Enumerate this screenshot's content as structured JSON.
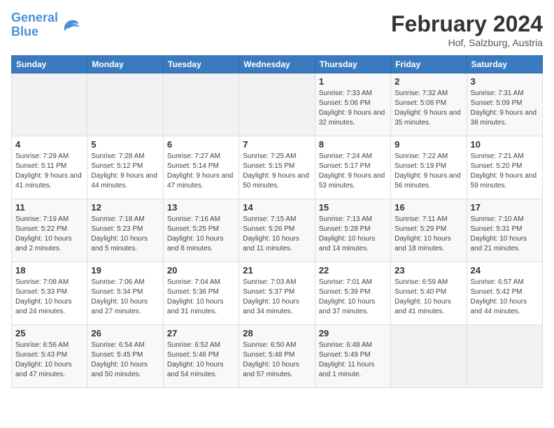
{
  "header": {
    "logo_line1": "General",
    "logo_line2": "Blue",
    "month_year": "February 2024",
    "location": "Hof, Salzburg, Austria"
  },
  "days_of_week": [
    "Sunday",
    "Monday",
    "Tuesday",
    "Wednesday",
    "Thursday",
    "Friday",
    "Saturday"
  ],
  "weeks": [
    [
      {
        "day": "",
        "sunrise": "",
        "sunset": "",
        "daylight": "",
        "empty": true
      },
      {
        "day": "",
        "sunrise": "",
        "sunset": "",
        "daylight": "",
        "empty": true
      },
      {
        "day": "",
        "sunrise": "",
        "sunset": "",
        "daylight": "",
        "empty": true
      },
      {
        "day": "",
        "sunrise": "",
        "sunset": "",
        "daylight": "",
        "empty": true
      },
      {
        "day": "1",
        "sunrise": "Sunrise: 7:33 AM",
        "sunset": "Sunset: 5:06 PM",
        "daylight": "Daylight: 9 hours and 32 minutes.",
        "empty": false
      },
      {
        "day": "2",
        "sunrise": "Sunrise: 7:32 AM",
        "sunset": "Sunset: 5:08 PM",
        "daylight": "Daylight: 9 hours and 35 minutes.",
        "empty": false
      },
      {
        "day": "3",
        "sunrise": "Sunrise: 7:31 AM",
        "sunset": "Sunset: 5:09 PM",
        "daylight": "Daylight: 9 hours and 38 minutes.",
        "empty": false
      }
    ],
    [
      {
        "day": "4",
        "sunrise": "Sunrise: 7:29 AM",
        "sunset": "Sunset: 5:11 PM",
        "daylight": "Daylight: 9 hours and 41 minutes.",
        "empty": false
      },
      {
        "day": "5",
        "sunrise": "Sunrise: 7:28 AM",
        "sunset": "Sunset: 5:12 PM",
        "daylight": "Daylight: 9 hours and 44 minutes.",
        "empty": false
      },
      {
        "day": "6",
        "sunrise": "Sunrise: 7:27 AM",
        "sunset": "Sunset: 5:14 PM",
        "daylight": "Daylight: 9 hours and 47 minutes.",
        "empty": false
      },
      {
        "day": "7",
        "sunrise": "Sunrise: 7:25 AM",
        "sunset": "Sunset: 5:15 PM",
        "daylight": "Daylight: 9 hours and 50 minutes.",
        "empty": false
      },
      {
        "day": "8",
        "sunrise": "Sunrise: 7:24 AM",
        "sunset": "Sunset: 5:17 PM",
        "daylight": "Daylight: 9 hours and 53 minutes.",
        "empty": false
      },
      {
        "day": "9",
        "sunrise": "Sunrise: 7:22 AM",
        "sunset": "Sunset: 5:19 PM",
        "daylight": "Daylight: 9 hours and 56 minutes.",
        "empty": false
      },
      {
        "day": "10",
        "sunrise": "Sunrise: 7:21 AM",
        "sunset": "Sunset: 5:20 PM",
        "daylight": "Daylight: 9 hours and 59 minutes.",
        "empty": false
      }
    ],
    [
      {
        "day": "11",
        "sunrise": "Sunrise: 7:19 AM",
        "sunset": "Sunset: 5:22 PM",
        "daylight": "Daylight: 10 hours and 2 minutes.",
        "empty": false
      },
      {
        "day": "12",
        "sunrise": "Sunrise: 7:18 AM",
        "sunset": "Sunset: 5:23 PM",
        "daylight": "Daylight: 10 hours and 5 minutes.",
        "empty": false
      },
      {
        "day": "13",
        "sunrise": "Sunrise: 7:16 AM",
        "sunset": "Sunset: 5:25 PM",
        "daylight": "Daylight: 10 hours and 8 minutes.",
        "empty": false
      },
      {
        "day": "14",
        "sunrise": "Sunrise: 7:15 AM",
        "sunset": "Sunset: 5:26 PM",
        "daylight": "Daylight: 10 hours and 11 minutes.",
        "empty": false
      },
      {
        "day": "15",
        "sunrise": "Sunrise: 7:13 AM",
        "sunset": "Sunset: 5:28 PM",
        "daylight": "Daylight: 10 hours and 14 minutes.",
        "empty": false
      },
      {
        "day": "16",
        "sunrise": "Sunrise: 7:11 AM",
        "sunset": "Sunset: 5:29 PM",
        "daylight": "Daylight: 10 hours and 18 minutes.",
        "empty": false
      },
      {
        "day": "17",
        "sunrise": "Sunrise: 7:10 AM",
        "sunset": "Sunset: 5:31 PM",
        "daylight": "Daylight: 10 hours and 21 minutes.",
        "empty": false
      }
    ],
    [
      {
        "day": "18",
        "sunrise": "Sunrise: 7:08 AM",
        "sunset": "Sunset: 5:33 PM",
        "daylight": "Daylight: 10 hours and 24 minutes.",
        "empty": false
      },
      {
        "day": "19",
        "sunrise": "Sunrise: 7:06 AM",
        "sunset": "Sunset: 5:34 PM",
        "daylight": "Daylight: 10 hours and 27 minutes.",
        "empty": false
      },
      {
        "day": "20",
        "sunrise": "Sunrise: 7:04 AM",
        "sunset": "Sunset: 5:36 PM",
        "daylight": "Daylight: 10 hours and 31 minutes.",
        "empty": false
      },
      {
        "day": "21",
        "sunrise": "Sunrise: 7:03 AM",
        "sunset": "Sunset: 5:37 PM",
        "daylight": "Daylight: 10 hours and 34 minutes.",
        "empty": false
      },
      {
        "day": "22",
        "sunrise": "Sunrise: 7:01 AM",
        "sunset": "Sunset: 5:39 PM",
        "daylight": "Daylight: 10 hours and 37 minutes.",
        "empty": false
      },
      {
        "day": "23",
        "sunrise": "Sunrise: 6:59 AM",
        "sunset": "Sunset: 5:40 PM",
        "daylight": "Daylight: 10 hours and 41 minutes.",
        "empty": false
      },
      {
        "day": "24",
        "sunrise": "Sunrise: 6:57 AM",
        "sunset": "Sunset: 5:42 PM",
        "daylight": "Daylight: 10 hours and 44 minutes.",
        "empty": false
      }
    ],
    [
      {
        "day": "25",
        "sunrise": "Sunrise: 6:56 AM",
        "sunset": "Sunset: 5:43 PM",
        "daylight": "Daylight: 10 hours and 47 minutes.",
        "empty": false
      },
      {
        "day": "26",
        "sunrise": "Sunrise: 6:54 AM",
        "sunset": "Sunset: 5:45 PM",
        "daylight": "Daylight: 10 hours and 50 minutes.",
        "empty": false
      },
      {
        "day": "27",
        "sunrise": "Sunrise: 6:52 AM",
        "sunset": "Sunset: 5:46 PM",
        "daylight": "Daylight: 10 hours and 54 minutes.",
        "empty": false
      },
      {
        "day": "28",
        "sunrise": "Sunrise: 6:50 AM",
        "sunset": "Sunset: 5:48 PM",
        "daylight": "Daylight: 10 hours and 57 minutes.",
        "empty": false
      },
      {
        "day": "29",
        "sunrise": "Sunrise: 6:48 AM",
        "sunset": "Sunset: 5:49 PM",
        "daylight": "Daylight: 11 hours and 1 minute.",
        "empty": false
      },
      {
        "day": "",
        "sunrise": "",
        "sunset": "",
        "daylight": "",
        "empty": true
      },
      {
        "day": "",
        "sunrise": "",
        "sunset": "",
        "daylight": "",
        "empty": true
      }
    ]
  ]
}
